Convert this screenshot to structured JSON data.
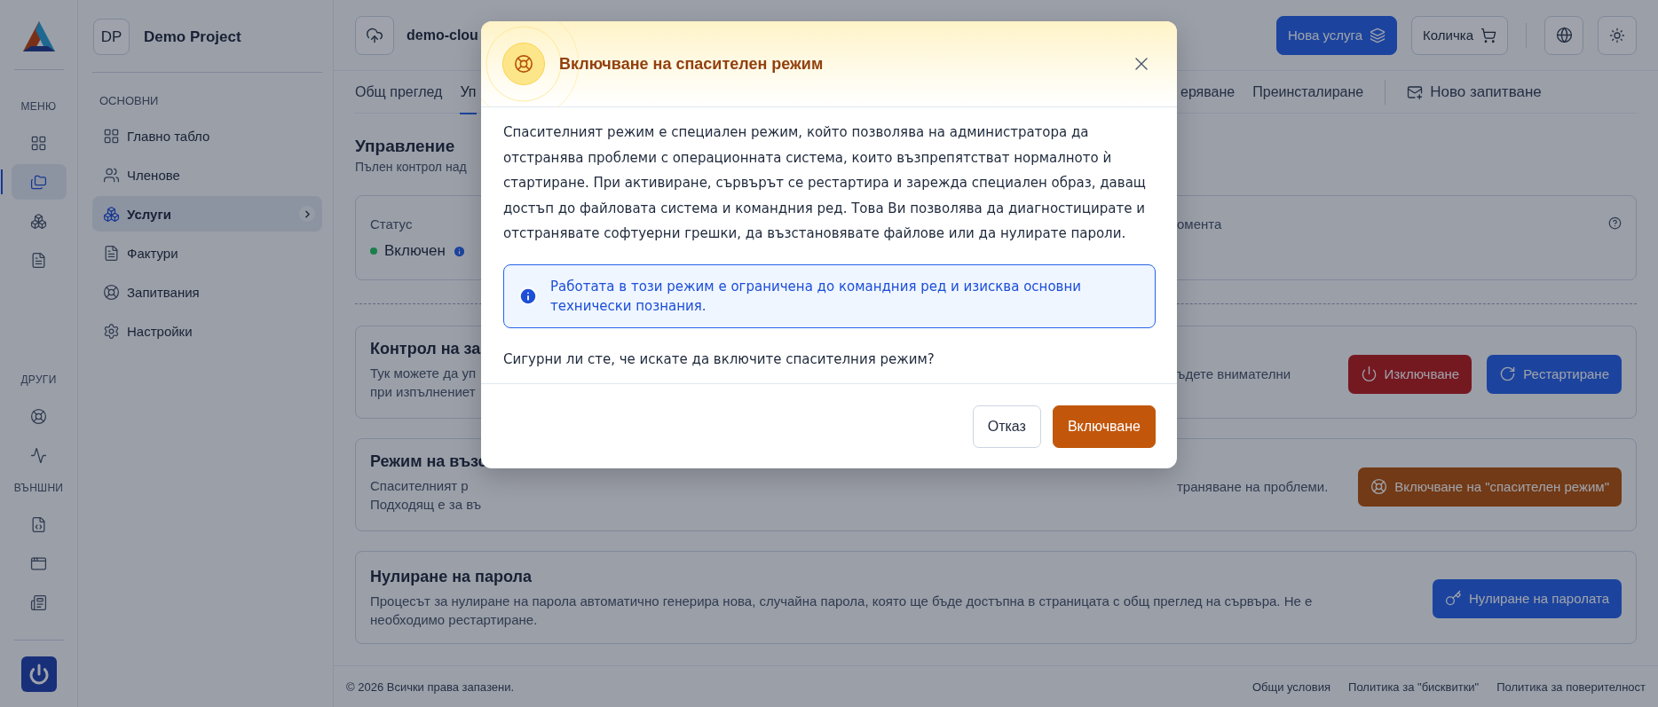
{
  "rail": {
    "sections": [
      {
        "label": "МЕНЮ",
        "items": [
          {
            "selected": false
          },
          {
            "selected": true
          },
          {
            "selected": false
          },
          {
            "selected": false
          }
        ]
      },
      {
        "label": "ДРУГИ",
        "items": [
          {
            "selected": false
          },
          {
            "selected": false
          }
        ]
      },
      {
        "label": "ВЪНШНИ",
        "items": [
          {
            "selected": false
          },
          {
            "selected": false
          },
          {
            "selected": false
          }
        ]
      }
    ]
  },
  "sidebar": {
    "project": {
      "initials": "DP",
      "name": "Demo Project"
    },
    "section_label": "ОСНОВНИ",
    "items": [
      {
        "label": "Главно табло",
        "selected": false
      },
      {
        "label": "Членове",
        "selected": false
      },
      {
        "label": "Услуги",
        "selected": true
      },
      {
        "label": "Фактури",
        "selected": false
      },
      {
        "label": "Запитвания",
        "selected": false
      },
      {
        "label": "Настройки",
        "selected": false
      }
    ]
  },
  "header": {
    "project_name": "demo-clou",
    "actions": [
      {
        "label": "Нова услуга",
        "kind": "primary"
      },
      {
        "label": "Количка",
        "kind": "outline"
      }
    ]
  },
  "tabs": [
    {
      "label": "Общ преглед",
      "selected": false
    },
    {
      "label": "Уп",
      "selected": true
    },
    {
      "label": "еряване",
      "selected": false
    },
    {
      "label": "Преинсталиране",
      "selected": false
    }
  ],
  "tab_action": {
    "label": "Ново запитване"
  },
  "section": {
    "title": "Управление",
    "subtitle": "Пълен контрол над"
  },
  "status_card": {
    "label": "Статус",
    "value": "Включен",
    "label_2": "омента"
  },
  "cards": [
    {
      "kind": "split",
      "title": "Контрол на за",
      "lines": [
        "Тук можете да уп",
        "при изпълнениет"
      ],
      "right_text": "ъдете внимателни",
      "buttons": [
        {
          "label": "Изключване",
          "kind": "danger"
        },
        {
          "label": "Рестартиране",
          "kind": "primary"
        }
      ]
    },
    {
      "kind": "split",
      "title": "Режим на възс",
      "lines": [
        "Спасителният р",
        "Подходящ е за въ"
      ],
      "right_text": "траняване на проблеми.",
      "buttons": [
        {
          "label": "Включване на \"спасителен режим\"",
          "kind": "warning"
        }
      ]
    },
    {
      "kind": "full",
      "title": "Нулиране на парола",
      "description": "Процесът за нулиране на парола автоматично генерира нова, случайна парола, която ще бъде достъпна в страницата с общ преглед на сървъра. Не е необходимо рестартиране.",
      "buttons": [
        {
          "label": "Нулиране на паролата",
          "kind": "primary"
        }
      ]
    }
  ],
  "footer": {
    "copyright": "© 2026 Всички права запазени.",
    "links": [
      "Общи условия",
      "Политика за \"бисквитки\"",
      "Политика за поверителност"
    ]
  },
  "modal": {
    "title": "Включване на спасителен режим",
    "body": "Спасителният режим е специален режим, който позволява на администратора да отстранява проблеми с операционната система, които възпрепятстват нормалното ѝ стартиране. При активиране, сървърът се рестартира и зарежда специален образ, даващ достъп до файловата система и командния ред. Това Ви позволява да диагностицирате и отстранявате софтуерни грешки, да възстановявате файлове или да нулирате пароли.",
    "notice": "Работата в този режим е ограничена до командния ред и изисква основни технически познания.",
    "question": "Сигурни ли сте, че искате да включите спасителния режим?",
    "buttons": [
      {
        "label": "Отказ",
        "kind": "secondary"
      },
      {
        "label": "Включване",
        "kind": "confirm"
      }
    ]
  }
}
